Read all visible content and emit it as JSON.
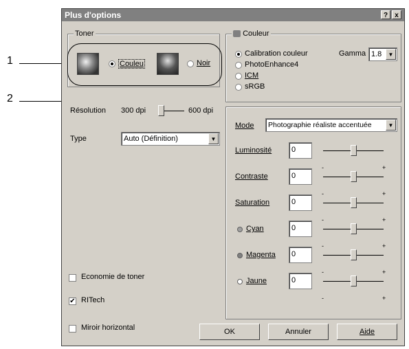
{
  "callouts": [
    "1",
    "2"
  ],
  "window": {
    "title": "Plus d'options",
    "help_btn": "?",
    "close_btn": "x"
  },
  "toner": {
    "label": "Toner",
    "color_option": "Couleu",
    "black_option": "Noir",
    "selected": "color"
  },
  "resolution": {
    "label": "Résolution",
    "low": "300 dpi",
    "high": "600 dpi"
  },
  "type": {
    "label": "Type",
    "value": "Auto (Définition)"
  },
  "couleur": {
    "label": "Couleur",
    "options": [
      "Calibration couleur",
      "PhotoEnhance4",
      "ICM",
      "sRGB"
    ],
    "selected_index": 0,
    "gamma_label": "Gamma",
    "gamma_value": "1.8"
  },
  "mode": {
    "label": "Mode",
    "value": "Photographie réaliste accentuée"
  },
  "adjustments": [
    {
      "label": "Luminosité",
      "value": "0",
      "marker_color": ""
    },
    {
      "label": "Contraste",
      "value": "0",
      "marker_color": ""
    },
    {
      "label": "Saturation",
      "value": "0",
      "marker_color": ""
    },
    {
      "label": "Cyan",
      "value": "0",
      "marker_color": "#a0a0a0"
    },
    {
      "label": "Magenta",
      "value": "0",
      "marker_color": "#808080"
    },
    {
      "label": "Jaune",
      "value": "0",
      "marker_color": "#ffffff"
    }
  ],
  "tick_minus": "-",
  "tick_plus": "+",
  "checkboxes": {
    "economie": {
      "label": "Economie de toner",
      "checked": false
    },
    "ritech": {
      "label": "RITech",
      "checked": true
    },
    "miroir": {
      "label": "Miroir horizontal",
      "checked": false
    }
  },
  "buttons": {
    "ok": "OK",
    "annuler": "Annuler",
    "aide": "Aide"
  }
}
